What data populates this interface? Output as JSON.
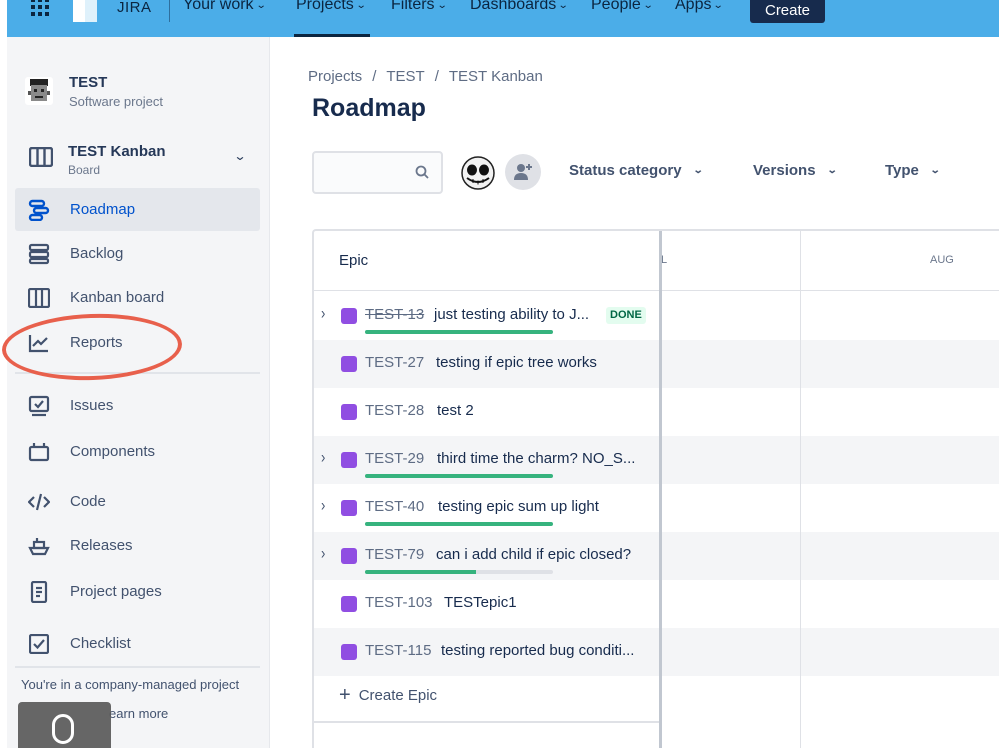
{
  "topnav": {
    "product": "JIRA",
    "items": [
      {
        "label": "Your work",
        "chevron": true
      },
      {
        "label": "Projects",
        "chevron": true,
        "active": true
      },
      {
        "label": "Filters",
        "chevron": true
      },
      {
        "label": "Dashboards",
        "chevron": true
      },
      {
        "label": "People",
        "chevron": true
      },
      {
        "label": "Apps",
        "chevron": true
      }
    ],
    "create_label": "Create",
    "colors": {
      "bar": "#4bade8",
      "create_bg": "#172b4d"
    }
  },
  "sidebar": {
    "project_name": "TEST",
    "project_type": "Software project",
    "board_name": "TEST Kanban",
    "board_type": "Board",
    "items": [
      {
        "label": "Roadmap",
        "icon": "roadmap-icon",
        "selected": true
      },
      {
        "label": "Backlog",
        "icon": "backlog-icon"
      },
      {
        "label": "Kanban board",
        "icon": "kanban-board-icon"
      },
      {
        "label": "Reports",
        "icon": "reports-icon",
        "annotated": true
      },
      {
        "label": "Issues",
        "icon": "issues-icon"
      },
      {
        "label": "Components",
        "icon": "components-icon"
      },
      {
        "label": "Code",
        "icon": "code-icon"
      },
      {
        "label": "Releases",
        "icon": "releases-icon"
      },
      {
        "label": "Project pages",
        "icon": "project-pages-icon"
      },
      {
        "label": "Checklist",
        "icon": "checklist-icon"
      }
    ],
    "footer_text": "You're in a company-managed project",
    "learn_more": "earn more"
  },
  "breadcrumb": [
    "Projects",
    "TEST",
    "TEST Kanban"
  ],
  "page_title": "Roadmap",
  "search": {
    "placeholder": "",
    "value": ""
  },
  "filters": [
    {
      "label": "Status category"
    },
    {
      "label": "Versions"
    },
    {
      "label": "Type"
    }
  ],
  "roadmap": {
    "epic_header": "Epic",
    "timeline_columns": [
      "L",
      "AUG"
    ],
    "epics": [
      {
        "key": "TEST-13",
        "summary": "just testing ability to J...",
        "status": "DONE",
        "expandable": true,
        "done": true,
        "progress": 1.0
      },
      {
        "key": "TEST-27",
        "summary": "testing if epic tree works",
        "expandable": false
      },
      {
        "key": "TEST-28",
        "summary": "test 2",
        "expandable": false
      },
      {
        "key": "TEST-29",
        "summary": "third time the charm? NO_S...",
        "expandable": true,
        "progress": 1.0
      },
      {
        "key": "TEST-40",
        "summary": "testing epic sum up light",
        "expandable": true,
        "progress": 1.0
      },
      {
        "key": "TEST-79",
        "summary": "can i add child if epic closed?",
        "expandable": true,
        "progress": 0.59
      },
      {
        "key": "TEST-103",
        "summary": "TESTepic1",
        "expandable": false
      },
      {
        "key": "TEST-115",
        "summary": "testing reported bug conditi...",
        "expandable": false
      }
    ],
    "create_epic_label": "Create Epic",
    "colors": {
      "epic_icon": "#904ee2",
      "progress": "#36b37e",
      "done_badge_bg": "#e3fcef",
      "done_badge_text": "#006644"
    }
  }
}
